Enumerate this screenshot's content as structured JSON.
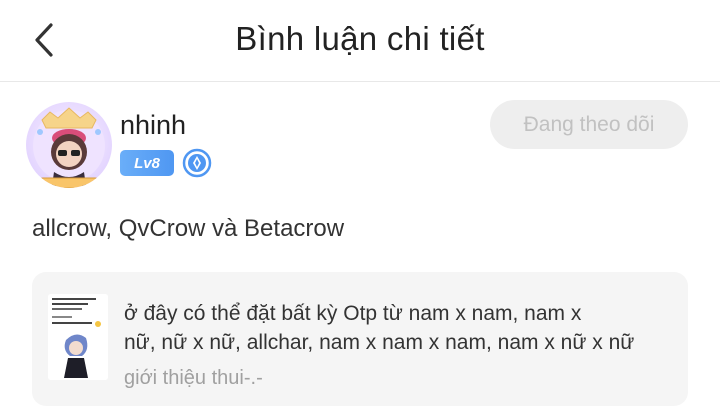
{
  "header": {
    "title": "Bình luận chi tiết",
    "back_icon": "chevron-left-icon"
  },
  "user": {
    "name": "nhinh",
    "level": "Lv8",
    "follow_label": "Đang theo dõi",
    "verify_icon": "verified-badge-icon"
  },
  "comment": {
    "text": "allcrow, QvCrow và Betacrow"
  },
  "story": {
    "description_line1": "ở đây có thể đặt bất kỳ Otp từ nam  x nam, nam x",
    "description_line2": "nữ, nữ x nữ, allchar, nam x nam x nam, nam x nữ x nữ",
    "subtitle": "giới thiệu thui-.-"
  },
  "colors": {
    "level_badge": "#4f97f2",
    "follow_bg": "#eeeeee",
    "card_bg": "#f5f5f5"
  }
}
